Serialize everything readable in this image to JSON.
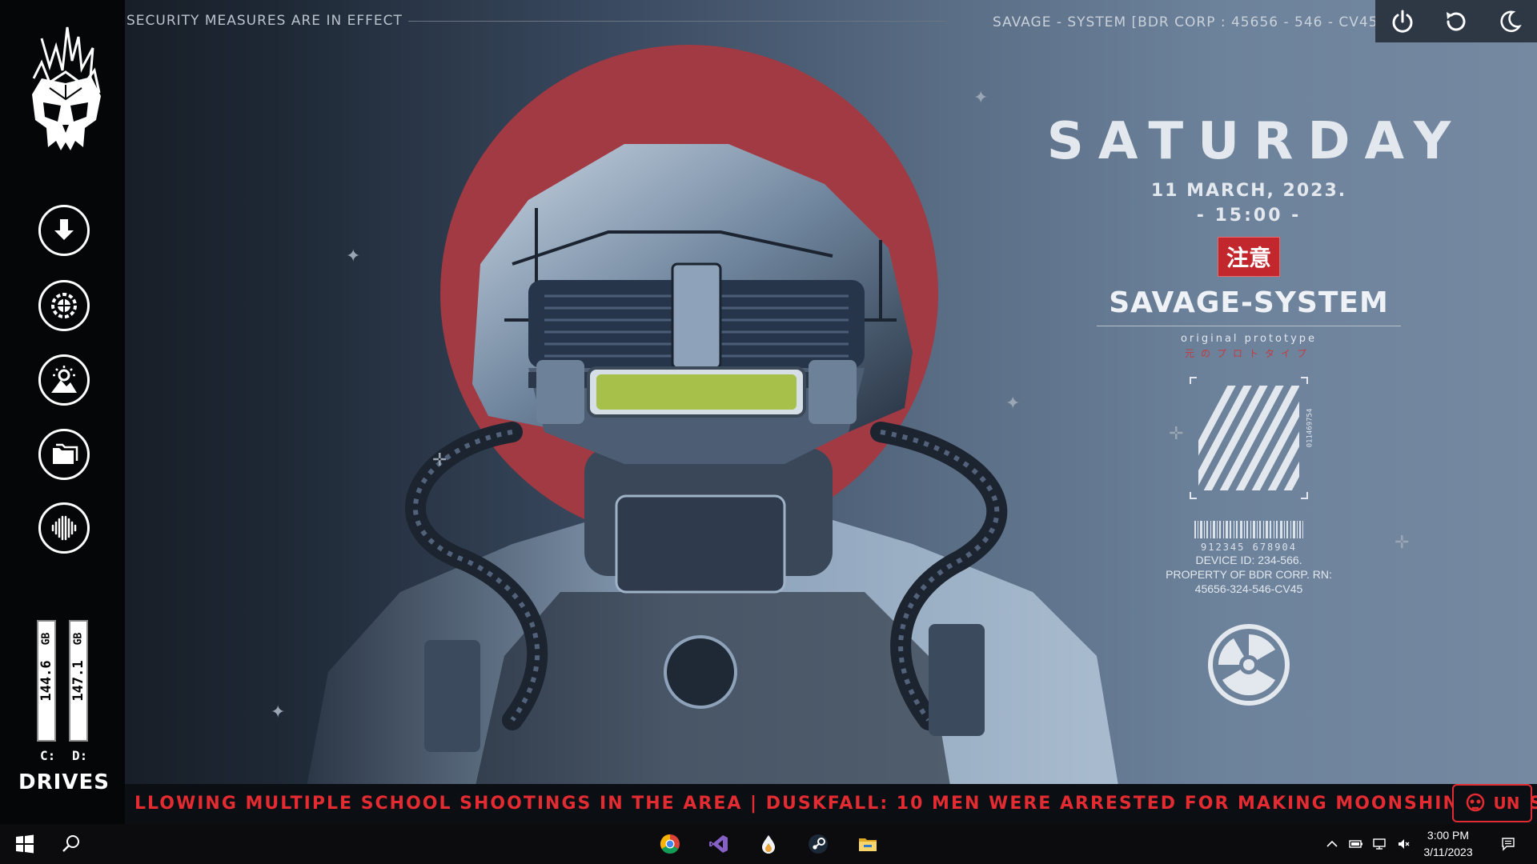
{
  "topbar": {
    "security_text": "SECURITY MEASURES ARE IN EFFECT",
    "system_text": "SAVAGE - SYSTEM [BDR CORP : 45656 - 546 - CV45 ]"
  },
  "power_panel": {
    "buttons": [
      {
        "icon": "power-icon",
        "label": "Power"
      },
      {
        "icon": "restart-icon",
        "label": "Restart"
      },
      {
        "icon": "sleep-icon",
        "label": "Sleep"
      }
    ]
  },
  "sidebar": {
    "buttons": [
      {
        "icon": "download-icon"
      },
      {
        "icon": "settings-gear-icon"
      },
      {
        "icon": "picture-icon"
      },
      {
        "icon": "folder-icon"
      },
      {
        "icon": "audio-wave-icon"
      }
    ],
    "drives": {
      "title": "DRIVES",
      "items": [
        {
          "letter": "C:",
          "value": "144.6",
          "unit": "GB"
        },
        {
          "letter": "D:",
          "value": "147.1",
          "unit": "GB"
        }
      ]
    }
  },
  "info": {
    "day": "SATURDAY",
    "date": "11 MARCH, 2023.",
    "time": "- 15:00 -",
    "warning_badge": "注意",
    "brand": "SAVAGE-SYSTEM",
    "subtitle_en": "original prototype",
    "subtitle_jp": "元のプロトタイプ",
    "hazard_code": "011469754",
    "barcode_number": "912345 678904",
    "device_lines": [
      "DEVICE ID: 234-566.",
      "PROPERTY OF BDR CORP. RN:",
      "45656-324-546-CV45"
    ]
  },
  "ticker": {
    "text": "LLOWING MULTIPLE SCHOOL SHOOTINGS IN THE AREA | DUSKFALL: 10 MEN WERE ARRESTED FOR MAKING MOONSHINE IN OSWALD",
    "button_label": "UN"
  },
  "taskbar": {
    "apps": [
      {
        "name": "Google Chrome"
      },
      {
        "name": "Visual Studio"
      },
      {
        "name": "Water drop app"
      },
      {
        "name": "Steam"
      },
      {
        "name": "File Explorer"
      }
    ],
    "clock_time": "3:00 PM",
    "clock_date": "3/11/2023"
  },
  "colors": {
    "accent_red": "#c1272d",
    "sun_red": "#a23a43",
    "ticker_red": "#e32b32",
    "sidebar_bg": "#050607"
  }
}
